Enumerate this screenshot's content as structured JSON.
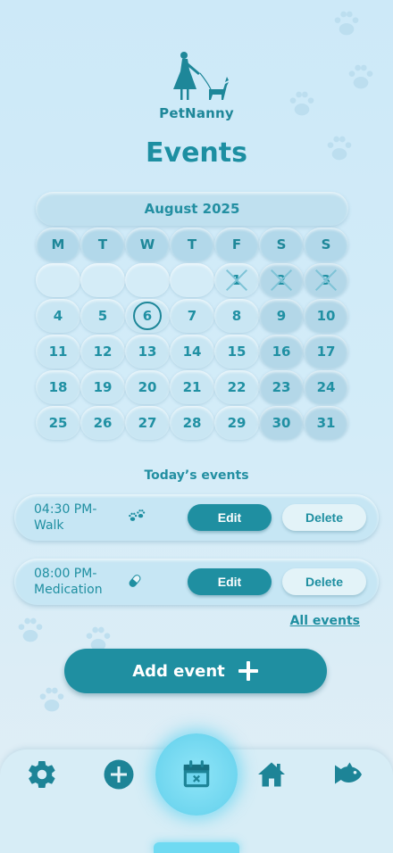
{
  "app": {
    "brand": "PetNanny"
  },
  "page": {
    "title": "Events"
  },
  "calendar": {
    "month_label": "August 2025",
    "weekdays": [
      "M",
      "T",
      "W",
      "T",
      "F",
      "S",
      "S"
    ],
    "weeks": [
      [
        "",
        "",
        "",
        "",
        "1",
        "2",
        "3"
      ],
      [
        "4",
        "5",
        "6",
        "7",
        "8",
        "9",
        "10"
      ],
      [
        "11",
        "12",
        "13",
        "14",
        "15",
        "16",
        "17"
      ],
      [
        "18",
        "19",
        "20",
        "21",
        "22",
        "23",
        "24"
      ],
      [
        "25",
        "26",
        "27",
        "28",
        "29",
        "30",
        "31"
      ]
    ],
    "crossed_days": [
      "1",
      "2",
      "3"
    ],
    "today": "6"
  },
  "events_section": {
    "title": "Today’s events",
    "all_events_label": "All events"
  },
  "events": [
    {
      "time": "04:30 PM-",
      "name": "Walk",
      "icon": "paw-icon",
      "edit_label": "Edit",
      "delete_label": "Delete"
    },
    {
      "time": "08:00 PM-",
      "name": "Medication",
      "icon": "pill-icon",
      "edit_label": "Edit",
      "delete_label": "Delete"
    }
  ],
  "add_event": {
    "label": "Add event"
  },
  "nav": {
    "items": [
      "settings-icon",
      "add-circle-icon",
      "calendar-icon",
      "home-icon",
      "fish-icon"
    ],
    "active": "calendar-icon"
  },
  "colors": {
    "accent": "#1f8fa1",
    "background": "#cde9f8",
    "active_glow": "#6fd6ef"
  }
}
